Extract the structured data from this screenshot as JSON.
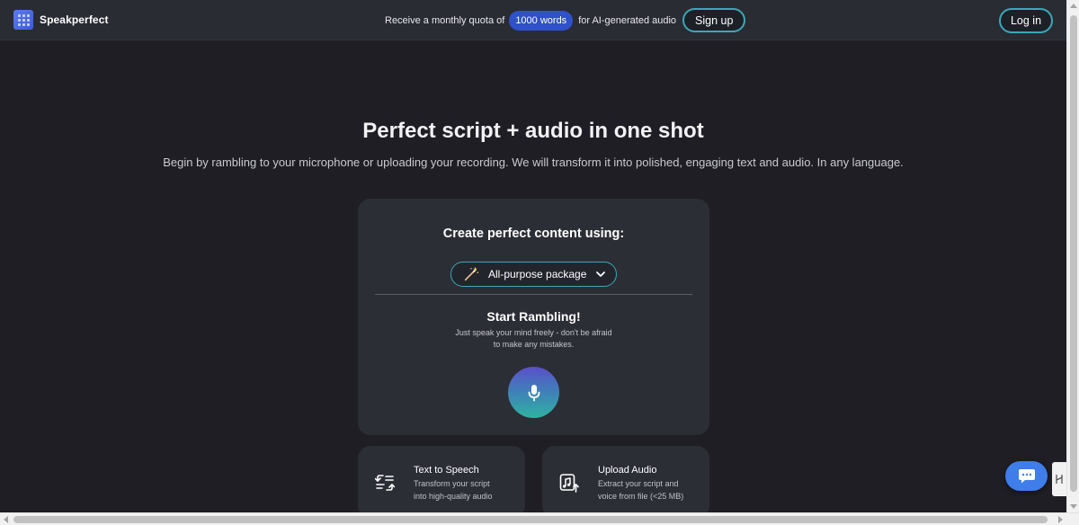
{
  "header": {
    "brand": "Speakperfect",
    "promo_prefix": "Receive a monthly quota of",
    "promo_badge": "1000 words",
    "promo_suffix": "for AI-generated audio",
    "signup_label": "Sign up",
    "login_label": "Log in"
  },
  "hero": {
    "title": "Perfect script + audio in one shot",
    "subtitle": "Begin by rambling to your microphone or uploading your recording. We will transform it into polished, engaging text and audio. In any language."
  },
  "create_card": {
    "title": "Create perfect content using:",
    "package_label": "All-purpose package",
    "ramble_title": "Start Rambling!",
    "ramble_line1": "Just speak your mind freely - don't be afraid",
    "ramble_line2": "to make any mistakes."
  },
  "options": [
    {
      "title": "Text to Speech",
      "line1": "Transform your script",
      "line2": "into high-quality audio",
      "icon": "text-to-speech-icon"
    },
    {
      "title": "Upload Audio",
      "line1": "Extract your script and",
      "line2": "voice from file (<25 MB)",
      "icon": "upload-audio-icon"
    }
  ],
  "colors": {
    "background": "#1e1e24",
    "header": "#2a2c34",
    "card": "#2c2e36",
    "accent_outline": "#3aa9b8",
    "badge": "#2f51c9",
    "chat_button": "#3f7de8"
  },
  "icons": [
    "logo-icon",
    "magic-wand-icon",
    "chevron-down-icon",
    "microphone-icon",
    "chat-icon",
    "side-tab-icon"
  ]
}
